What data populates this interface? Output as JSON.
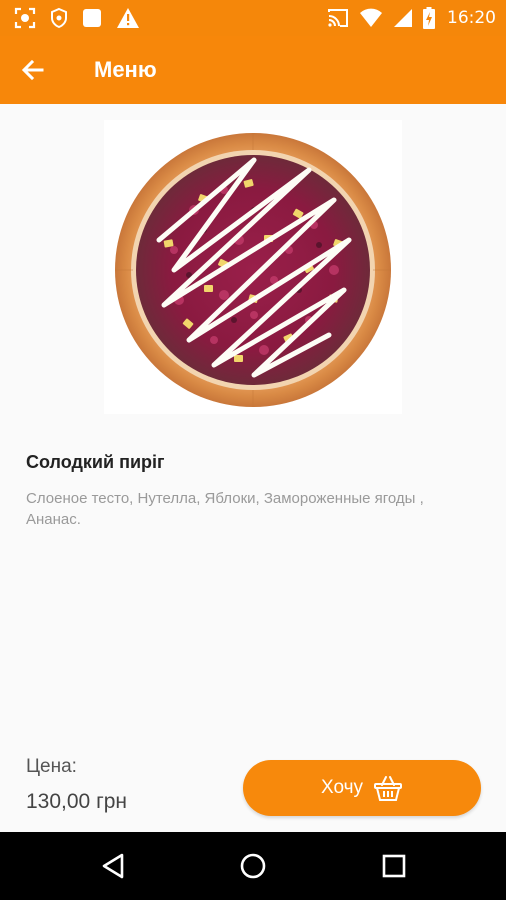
{
  "status_bar": {
    "time": "16:20",
    "icons": [
      "screenshot-icon",
      "shield-icon",
      "notification-square-icon",
      "warning-icon",
      "cast-icon",
      "wifi-icon",
      "cell-signal-icon",
      "battery-charging-icon"
    ]
  },
  "app_bar": {
    "back_icon": "arrow-left-icon",
    "title": "Меню"
  },
  "product": {
    "image": "pizza-image",
    "name": "Солодкий пиріг",
    "description": "Слоеное тесто, Нутелла, Яблоки, Замороженные ягоды , Ананас."
  },
  "price": {
    "label": "Цена:",
    "value": "130,00 грн"
  },
  "action": {
    "label": "Хочу",
    "icon": "basket-icon"
  },
  "nav_bar": {
    "icons": [
      "back-triangle-icon",
      "home-circle-icon",
      "recents-square-icon"
    ]
  },
  "colors": {
    "accent": "#f7870a",
    "background": "#fafafa",
    "title_text": "#222222",
    "description_text": "#9a9a9a"
  }
}
